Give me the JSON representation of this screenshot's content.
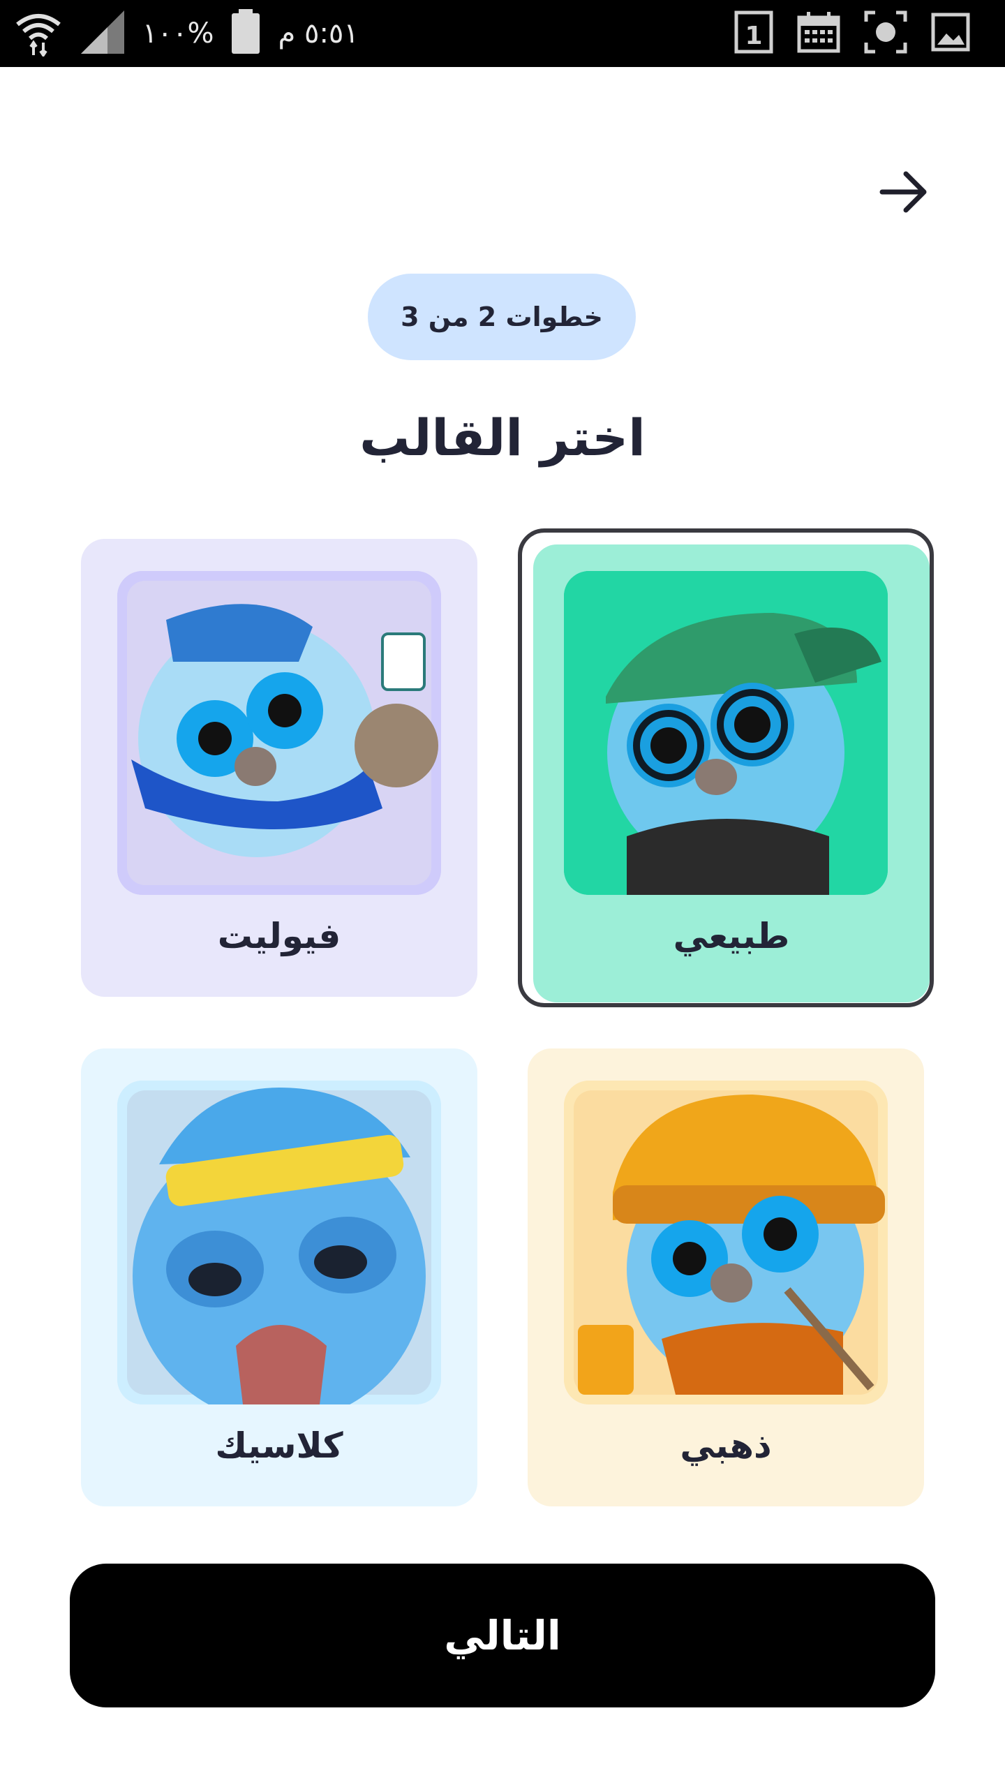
{
  "status_bar": {
    "time": "٥:٥١ م",
    "battery": "%١٠٠",
    "icons": [
      "battery-icon",
      "signal-icon",
      "wifi-icon",
      "calendar-day-icon",
      "calendar-icon",
      "screenshot-icon",
      "gallery-icon"
    ],
    "calendar_day": "1"
  },
  "header": {
    "back_icon": "arrow-right-icon"
  },
  "progress": {
    "step_label": "خطوات 2 من 3"
  },
  "main": {
    "title": "اختر القالب",
    "templates": [
      {
        "id": "natural",
        "label": "طبيعي",
        "selected": true,
        "card_color": "#9ceed7",
        "accent": "#22d6a4"
      },
      {
        "id": "violet",
        "label": "فيوليت",
        "selected": false,
        "card_color": "#e8e7fb",
        "accent": "#cfcbfb"
      },
      {
        "id": "golden",
        "label": "ذهبي",
        "selected": false,
        "card_color": "#fdf3dc",
        "accent": "#fde7b3"
      },
      {
        "id": "classic",
        "label": "كلاسيك",
        "selected": false,
        "card_color": "#e6f6ff",
        "accent": "#cdeeff"
      }
    ]
  },
  "footer": {
    "next_label": "التالي"
  }
}
